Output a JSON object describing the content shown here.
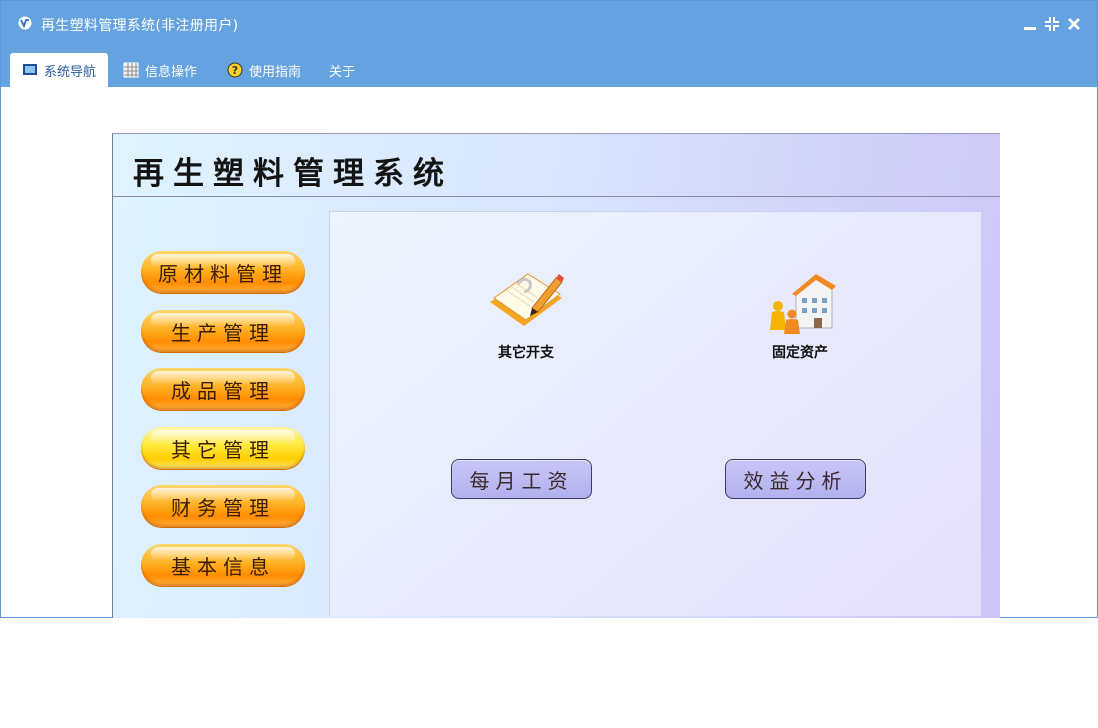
{
  "window": {
    "title": "再生塑料管理系统(非注册用户)"
  },
  "menu": {
    "tabs": [
      {
        "label": "系统导航",
        "icon": "monitor-icon",
        "active": true
      },
      {
        "label": "信息操作",
        "icon": "grid-icon",
        "active": false
      },
      {
        "label": "使用指南",
        "icon": "help-icon",
        "active": false
      },
      {
        "label": "关于",
        "icon": "",
        "active": false
      }
    ]
  },
  "panel": {
    "title": "再生塑料管理系统",
    "side_buttons": [
      {
        "label": "原材料管理",
        "selected": false
      },
      {
        "label": "生产管理",
        "selected": false
      },
      {
        "label": "成品管理",
        "selected": false
      },
      {
        "label": "其它管理",
        "selected": true
      },
      {
        "label": "财务管理",
        "selected": false
      },
      {
        "label": "基本信息",
        "selected": false
      }
    ],
    "icon_items": [
      {
        "label": "其它开支",
        "icon": "notebook-pencil-icon"
      },
      {
        "label": "固定资产",
        "icon": "house-people-icon"
      }
    ],
    "rect_buttons": [
      {
        "label": "每月工资"
      },
      {
        "label": "效益分析"
      }
    ]
  },
  "colors": {
    "titlebar": "#64a3e0",
    "accent_orange": "#ff8c00",
    "selected_yellow": "#ffe83a",
    "rect_button": "#b3b1ee"
  }
}
